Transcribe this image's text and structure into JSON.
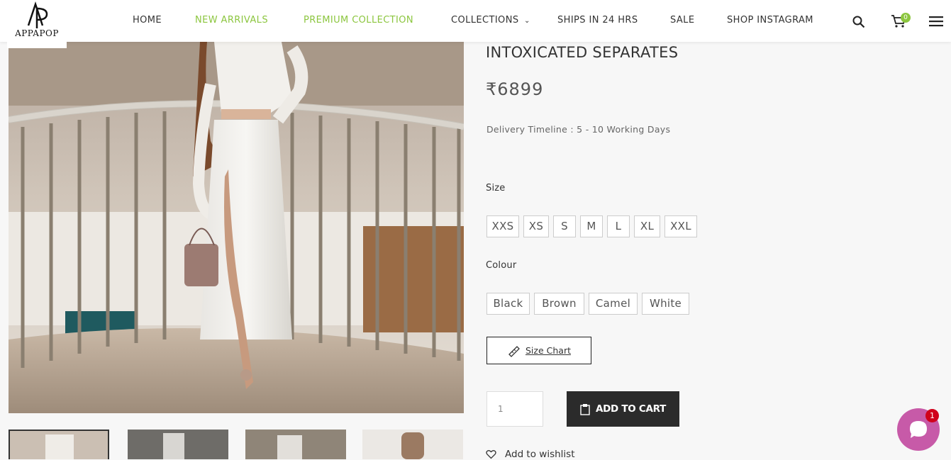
{
  "brand": {
    "logo_text": "APPAPOP"
  },
  "nav": {
    "items": [
      {
        "label": "HOME",
        "highlight": false
      },
      {
        "label": "NEW ARRIVALS",
        "highlight": true
      },
      {
        "label": "PREMIUM COLLECTION",
        "highlight": true
      },
      {
        "label": "COLLECTIONS",
        "highlight": false,
        "has_dropdown": true
      },
      {
        "label": "SHIPS IN 24 HRS",
        "highlight": false
      },
      {
        "label": "SALE",
        "highlight": false
      },
      {
        "label": "SHOP INSTAGRAM",
        "highlight": false
      }
    ],
    "dropdown_glyph": "⌄",
    "icons": [
      "search-icon",
      "cart-icon",
      "menu-icon"
    ],
    "cart_count": "0",
    "accent": "#8cc63f"
  },
  "product": {
    "title": "INTOXICATED SEPARATES",
    "price": "₹6899",
    "delivery": "Delivery Timeline : 5 - 10 Working Days",
    "size_label": "Size",
    "sizes": [
      "XXS",
      "XS",
      "S",
      "M",
      "L",
      "XL",
      "XXL"
    ],
    "colour_label": "Colour",
    "colours": [
      "Black",
      "Brown",
      "Camel",
      "White"
    ],
    "size_chart_label": "Size Chart",
    "quantity": "1",
    "add_to_cart_label": "ADD TO CART",
    "wishlist_label": "Add to wishlist"
  },
  "chat": {
    "badge": "1",
    "color": "#c75aa8"
  }
}
